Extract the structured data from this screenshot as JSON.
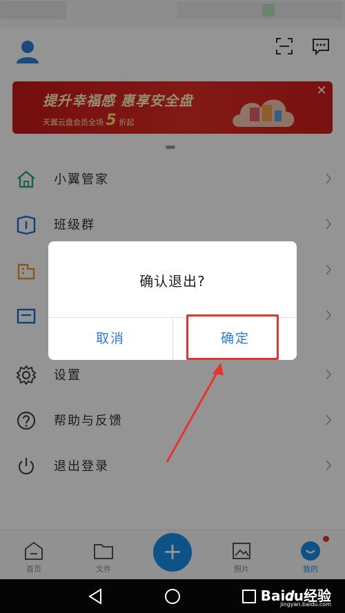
{
  "menu": {
    "items": [
      {
        "label": "小翼管家",
        "icon": "home-icon"
      },
      {
        "label": "班级群",
        "icon": "book-icon"
      },
      {
        "label": "",
        "icon": "building-icon"
      },
      {
        "label": "",
        "icon": "mail-icon"
      },
      {
        "label": "设置",
        "icon": "gear-icon"
      },
      {
        "label": "帮助与反馈",
        "icon": "help-icon"
      },
      {
        "label": "退出登录",
        "icon": "power-icon"
      }
    ]
  },
  "banner": {
    "title": "提升幸福感 惠享安全盘",
    "subtitle_prefix": "天翼云盘会员全场",
    "subtitle_number": "5",
    "subtitle_suffix": "折起",
    "close_symbol": "✕"
  },
  "tabbar": {
    "tabs": [
      {
        "label": "首页",
        "icon": "home-tab-icon"
      },
      {
        "label": "文件",
        "icon": "folder-icon"
      },
      {
        "label": "",
        "icon": "plus-icon"
      },
      {
        "label": "照片",
        "icon": "image-icon"
      },
      {
        "label": "我的",
        "icon": "profile-icon",
        "active": true,
        "badge": true
      }
    ],
    "fab_symbol": "+"
  },
  "dialog": {
    "title": "确认退出?",
    "cancel_label": "取消",
    "confirm_label": "确定"
  },
  "watermark": {
    "brand": "Bai𝒅u经验",
    "url": "jingyan.baidu.com"
  },
  "colors": {
    "accent": "#1a8de8",
    "dialog_button": "#2b7ce0",
    "highlight": "#e8322e",
    "banner": "#d11e1e",
    "home_icon": "#2aa67a",
    "book_icon": "#1a6fd0",
    "building_icon": "#e59a2a",
    "mail_icon": "#1a6fd0"
  }
}
